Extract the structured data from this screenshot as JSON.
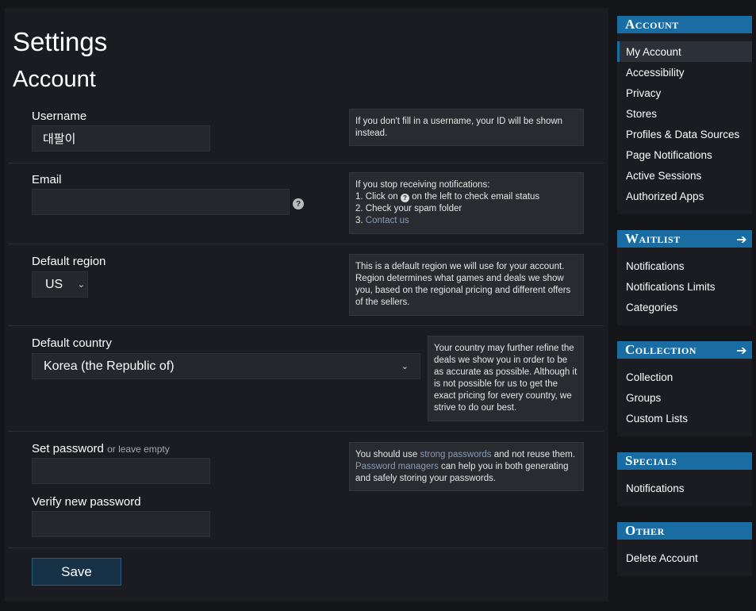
{
  "page": {
    "title": "Settings",
    "section": "Account"
  },
  "form": {
    "username": {
      "label": "Username",
      "value": "대팔이",
      "help": "If you don't fill in a username, your ID will be shown instead."
    },
    "email": {
      "label": "Email",
      "value": "",
      "help_title": "If you stop receiving notifications:",
      "help_1_prefix": "1. Click on",
      "help_1_suffix": "on the left to check email status",
      "help_2": "2. Check your spam folder",
      "help_3_prefix": "3.",
      "help_3_link": "Contact us"
    },
    "region": {
      "label": "Default region",
      "selected": "US",
      "help": "This is a default region we will use for your account. Region determines what games and deals we show you, based on the regional pricing and different offers of the sellers."
    },
    "country": {
      "label": "Default country",
      "selected": "Korea (the Republic of)",
      "help": "Your country may further refine the deals we show you in order to be as accurate as possible. Although it is not possible for us to get the exact pricing for every country, we strive to do our best."
    },
    "password": {
      "label": "Set password",
      "label_hint": "or leave empty",
      "verify_label": "Verify new password",
      "help_1": "You should use",
      "help_link_1": "strong passwords",
      "help_2": "and not reuse them.",
      "help_link_2": "Password managers",
      "help_3": "can help you in both generating and safely storing your passwords."
    },
    "save_label": "Save"
  },
  "sidebar": {
    "groups": [
      {
        "title": "Account",
        "arrow": false,
        "items": [
          "My Account",
          "Accessibility",
          "Privacy",
          "Stores",
          "Profiles & Data Sources",
          "Page Notifications",
          "Active Sessions",
          "Authorized Apps"
        ]
      },
      {
        "title": "Waitlist",
        "arrow": true,
        "items": [
          "Notifications",
          "Notifications Limits",
          "Categories"
        ]
      },
      {
        "title": "Collection",
        "arrow": true,
        "items": [
          "Collection",
          "Groups",
          "Custom Lists"
        ]
      },
      {
        "title": "Specials",
        "arrow": false,
        "items": [
          "Notifications"
        ]
      },
      {
        "title": "Other",
        "arrow": false,
        "items": [
          "Delete Account"
        ]
      }
    ],
    "active_item": "My Account"
  },
  "icons": {
    "help": "question-circle-icon",
    "arrow": "arrow-right-icon",
    "chevron": "chevron-down-icon"
  },
  "colors": {
    "accent": "#1a6da3",
    "background": "#141519",
    "panel": "#1b1c21",
    "link": "#8a9bb8"
  }
}
